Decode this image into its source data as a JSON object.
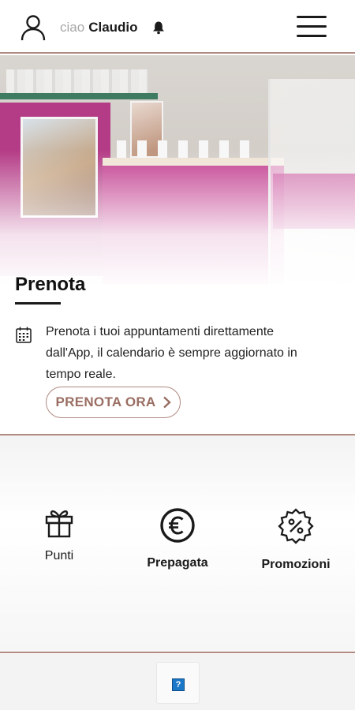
{
  "header": {
    "greeting": "ciao",
    "user_name": "Claudio",
    "icons": {
      "user": "user-icon",
      "bell": "bell-icon",
      "menu": "hamburger-menu-icon"
    }
  },
  "prenota": {
    "title": "Prenota",
    "description": "Prenota i tuoi appuntamenti direttamente dall'App, il calendario è sempre aggiornato in tempo reale.",
    "button_label": "PRENOTA ORA",
    "icon": "calendar-icon"
  },
  "features": [
    {
      "label": "Punti",
      "icon": "gift-icon"
    },
    {
      "label": "Prepagata",
      "icon": "euro-coin-icon"
    },
    {
      "label": "Promozioni",
      "icon": "percent-badge-icon"
    }
  ],
  "footer": {
    "help_label": "?",
    "icon": "help-icon"
  },
  "colors": {
    "accent": "#b08a80",
    "accent_text": "#9a6e62",
    "help_blue": "#1a78c9"
  }
}
